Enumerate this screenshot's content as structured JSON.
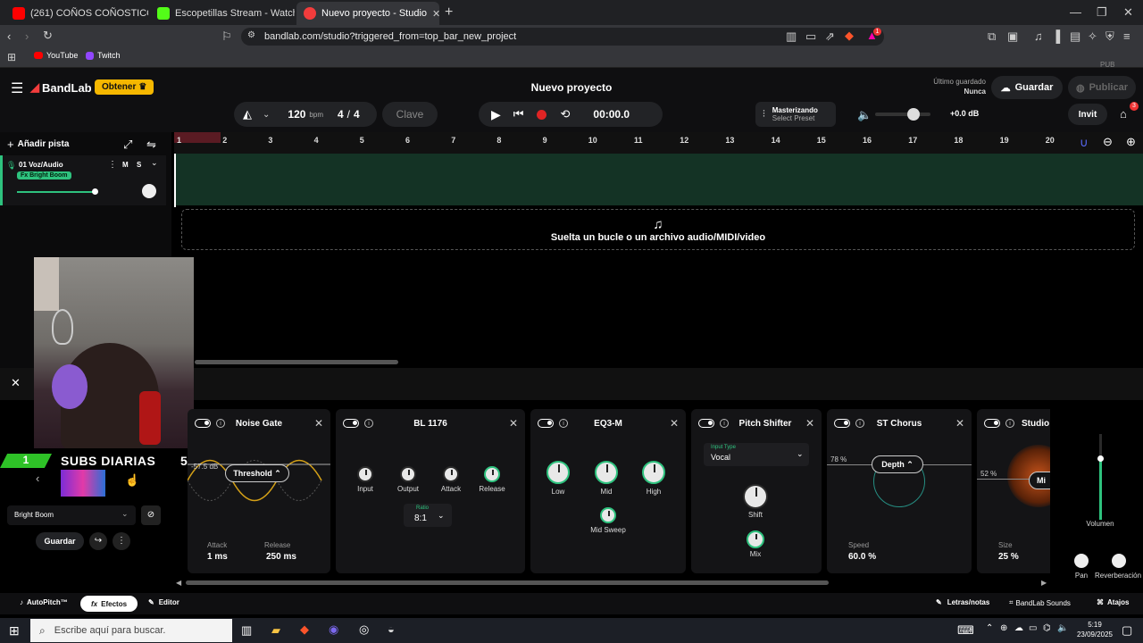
{
  "browser": {
    "tabs": [
      {
        "title": "(261) COÑOS COÑOSTICOS ARISTOC",
        "color": "#ff0000"
      },
      {
        "title": "Escopetillas Stream - Watch Live on",
        "color": "#53fc18"
      },
      {
        "title": "Nuevo proyecto - Studio",
        "color": "#f23c3c"
      }
    ],
    "url": "bandlab.com/studio?triggered_from=top_bar_new_project",
    "bookmarks": [
      "YouTube",
      "Twitch"
    ],
    "ext_badge": "1"
  },
  "app": {
    "brand": "BandLab",
    "obtener": "Obtener",
    "project_title": "Nuevo proyecto",
    "last_saved_label": "Último guardado",
    "last_saved_value": "Nunca",
    "save": "Guardar",
    "publish": "Publicar",
    "pub_tag": "PUB",
    "invite": "Invit",
    "notif_count": "3"
  },
  "transport": {
    "tempo": "120",
    "tempo_unit": "bpm",
    "time_sig_top": "4",
    "time_sig_bottom": "4",
    "key": "Clave",
    "time": "00:00.0",
    "mastering_title": "Masterizando",
    "mastering_preset": "Select Preset",
    "master_gain": "+0.0 dB"
  },
  "tracks": {
    "add_track": "Añadir pista",
    "track_name": "01  Voz/Audio",
    "mute": "M",
    "solo": "S",
    "fx_chip": "Fx Bright Boom"
  },
  "ruler": [
    "1",
    "2",
    "3",
    "4",
    "5",
    "6",
    "7",
    "8",
    "9",
    "10",
    "11",
    "12",
    "13",
    "14",
    "15",
    "16",
    "17",
    "18",
    "19",
    "20"
  ],
  "drop_zone": "Suelta un bucle o un archivo audio/MIDI/video",
  "overlay": {
    "subs_count": "1",
    "subs_text": "SUBS DIARIAS",
    "subs_goal": "5"
  },
  "fx": {
    "preset_name": "Bright Boom",
    "save": "Guardar",
    "noise_gate": {
      "title": "Noise Gate",
      "threshold": "Threshold",
      "db": "-57.5 dB",
      "attack_label": "Attack",
      "attack_value": "1 ms",
      "release_label": "Release",
      "release_value": "250 ms"
    },
    "bl1176": {
      "title": "BL 1176",
      "knobs": [
        "Input",
        "Output",
        "Attack",
        "Release"
      ],
      "ratio_label": "Ratio",
      "ratio_value": "8:1"
    },
    "eq3m": {
      "title": "EQ3-M",
      "knobs": [
        "Low",
        "Mid",
        "High"
      ],
      "sweep": "Mid Sweep"
    },
    "pitch": {
      "title": "Pitch Shifter",
      "input_type_label": "Input Type",
      "input_type": "Vocal",
      "shift": "Shift",
      "mix": "Mix"
    },
    "chorus": {
      "title": "ST Chorus",
      "pct": "78 %",
      "depth": "Depth",
      "speed_label": "Speed",
      "speed_value": "60.0 %"
    },
    "studio": {
      "title": "Studio",
      "pct": "52 %",
      "mix": "Mi",
      "size_label": "Size",
      "size_value": "25 %"
    },
    "volume": "Volumen",
    "pan": "Pan",
    "reverb": "Reverberación"
  },
  "bottom": {
    "autopitch": "AutoPitch™",
    "efectos": "Efectos",
    "editor": "Editor",
    "letras": "Letras/notas",
    "sounds": "BandLab Sounds",
    "atajos": "Atajos"
  },
  "taskbar": {
    "search": "Escribe aquí para buscar.",
    "time": "5:19",
    "date": "23/09/2025"
  }
}
